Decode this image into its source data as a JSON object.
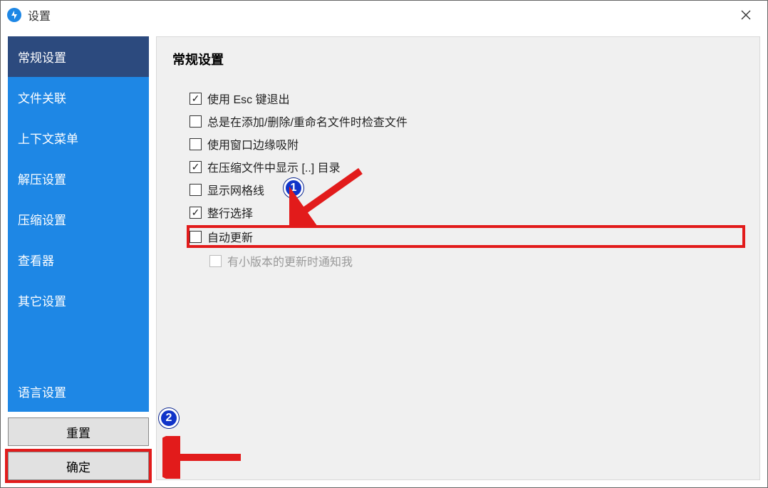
{
  "window": {
    "title": "设置"
  },
  "sidebar": {
    "items": [
      {
        "label": "常规设置",
        "active": true
      },
      {
        "label": "文件关联",
        "active": false
      },
      {
        "label": "上下文菜单",
        "active": false
      },
      {
        "label": "解压设置",
        "active": false
      },
      {
        "label": "压缩设置",
        "active": false
      },
      {
        "label": "查看器",
        "active": false
      },
      {
        "label": "其它设置",
        "active": false
      },
      {
        "label": "语言设置",
        "active": false
      }
    ]
  },
  "buttons": {
    "reset": "重置",
    "ok": "确定"
  },
  "main": {
    "heading": "常规设置",
    "options": [
      {
        "label": "使用 Esc 键退出",
        "checked": true,
        "disabled": false,
        "indent": false,
        "highlighted": false
      },
      {
        "label": "总是在添加/删除/重命名文件时检查文件",
        "checked": false,
        "disabled": false,
        "indent": false,
        "highlighted": false
      },
      {
        "label": "使用窗口边缘吸附",
        "checked": false,
        "disabled": false,
        "indent": false,
        "highlighted": false
      },
      {
        "label": "在压缩文件中显示 [..] 目录",
        "checked": true,
        "disabled": false,
        "indent": false,
        "highlighted": false
      },
      {
        "label": "显示网格线",
        "checked": false,
        "disabled": false,
        "indent": false,
        "highlighted": false
      },
      {
        "label": "整行选择",
        "checked": true,
        "disabled": false,
        "indent": false,
        "highlighted": false
      },
      {
        "label": "自动更新",
        "checked": false,
        "disabled": false,
        "indent": false,
        "highlighted": true
      },
      {
        "label": "有小版本的更新时通知我",
        "checked": false,
        "disabled": true,
        "indent": true,
        "highlighted": false
      }
    ]
  },
  "markers": {
    "one": "1",
    "two": "2"
  }
}
